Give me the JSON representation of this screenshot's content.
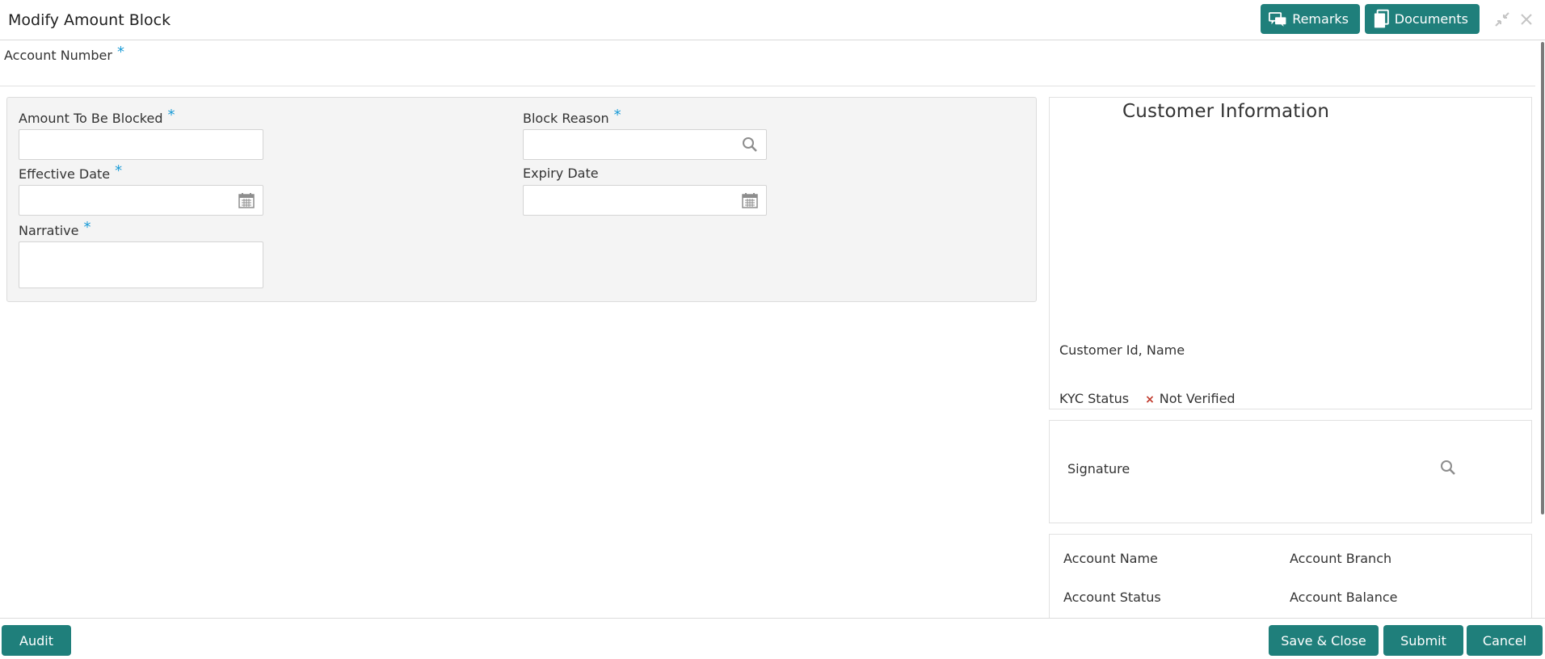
{
  "header": {
    "title": "Modify Amount Block",
    "remarks_label": "Remarks",
    "documents_label": "Documents"
  },
  "account": {
    "label": "Account Number",
    "required_mark": "*"
  },
  "form": {
    "amount_label": "Amount To Be Blocked",
    "amount_required": "*",
    "amount_value": "",
    "block_reason_label": "Block Reason",
    "block_reason_required": "*",
    "block_reason_value": "",
    "effective_date_label": "Effective Date",
    "effective_date_required": "*",
    "effective_date_value": "",
    "expiry_date_label": "Expiry Date",
    "expiry_date_value": "",
    "narrative_label": "Narrative",
    "narrative_required": "*",
    "narrative_value": ""
  },
  "customer": {
    "title": "Customer Information",
    "id_name_label": "Customer Id, Name",
    "kyc_label": "KYC Status",
    "kyc_status_mark": "×",
    "kyc_value": "Not Verified"
  },
  "signature": {
    "label": "Signature"
  },
  "account_info": {
    "name_label": "Account Name",
    "branch_label": "Account Branch",
    "status_label": "Account Status",
    "balance_label": "Account Balance"
  },
  "footer": {
    "audit_label": "Audit",
    "save_close_label": "Save & Close",
    "submit_label": "Submit",
    "cancel_label": "Cancel"
  },
  "colors": {
    "accent": "#1f7f7b",
    "required": "#1a9bd7",
    "kyc_status": "#c0392b"
  }
}
